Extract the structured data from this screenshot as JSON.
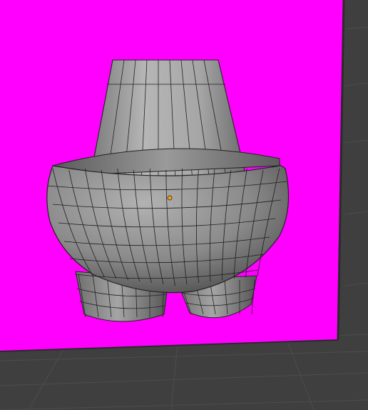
{
  "viewport": {
    "background": "#3f3f3f",
    "grid_line_color": "#4c4c4c",
    "backdrop_color": "#ff00ff",
    "mesh_colors": {
      "light": "#b9b9b9",
      "mid": "#8e8e8e",
      "dark": "#4a4a4a",
      "wire": "#1e1e1e"
    },
    "origin_color": "#ff9a1a",
    "object": {
      "shape": "mesh-vase-with-legs",
      "mode": "edit-wireframe-overlay"
    }
  }
}
